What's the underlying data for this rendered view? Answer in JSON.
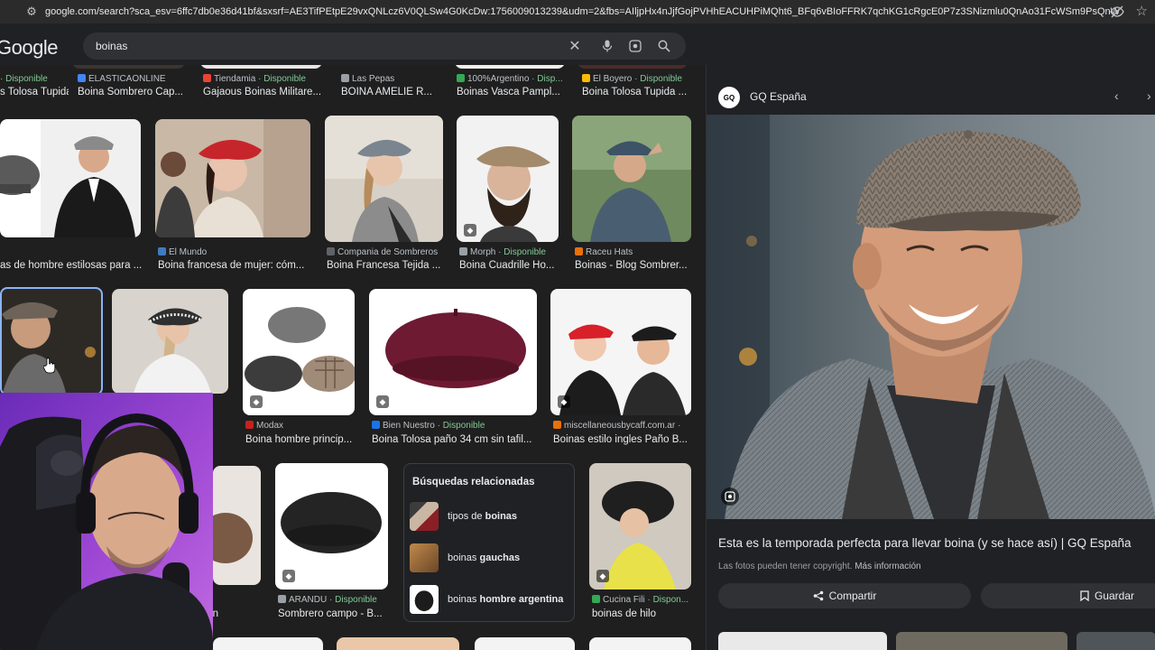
{
  "browser": {
    "url": "google.com/search?sca_esv=6ffc7db0e36d41bf&sxsrf=AE3TifPEtpE29vxQNLcz6V0QLSw4G0KcDw:1756009013239&udm=2&fbs=AIljpHx4nJjfGojPVHhEACUHPiMQht6_BFq6vBIoFFRK7qchKG1cRgcE0P7z3SNizmlu0QnAo31FcWSm9PsQnW8mPH2..."
  },
  "header": {
    "logo": "Google",
    "query": "boinas"
  },
  "row0": [
    {
      "meta": "· Disponible",
      "title": "s Tolosa Tupida ..."
    },
    {
      "meta": "ELASTICAONLINE",
      "title": "Boina Sombrero Cap..."
    },
    {
      "meta": "Tiendamia · Disponible",
      "source": "Tiendamia",
      "avail": "· Disponible",
      "title": "Gajaous Boinas Militare..."
    },
    {
      "meta": "Las Pepas",
      "title": "BOINA AMELIE R..."
    },
    {
      "source": "100%Argentino",
      "avail": "· Disp...",
      "title": "Boinas Vasca Pampl..."
    },
    {
      "source": "El Boyero",
      "avail": "· Disponible",
      "title": "Boina Tolosa Tupida ..."
    }
  ],
  "row1": [
    {
      "meta": "",
      "title": "as de hombre estilosas para ..."
    },
    {
      "source": "El Mundo",
      "title": "Boina francesa de mujer: cóm..."
    },
    {
      "source": "Compania de Sombreros",
      "title": "Boina Francesa Tejida ..."
    },
    {
      "source": "Morph",
      "avail": "· Disponible",
      "title": "Boina Cuadrille Ho..."
    },
    {
      "source": "Raceu Hats",
      "title": "Boinas - Blog Sombrer..."
    }
  ],
  "row2": [
    {
      "source": "Modax",
      "title": "Boina hombre princip..."
    },
    {
      "source": "Bien Nuestro",
      "avail": "· Disponible",
      "title": "Boina Tolosa paño 34 cm sin tafil..."
    },
    {
      "source": "miscellaneousbycaff.com.ar",
      "avail": "·",
      "title": "Boinas estilo ingles Paño B..."
    },
    {
      "left_title": "...n"
    }
  ],
  "row3": [
    {
      "source": "ARANDU",
      "avail": "· Disponible",
      "title": "Sombrero campo - B..."
    },
    {
      "source": "Cucina Fili",
      "avail": "· Dispon...",
      "title": "boinas de hilo"
    }
  ],
  "related": {
    "heading": "Búsquedas relacionadas",
    "items": [
      {
        "pre": "tipos de ",
        "bold": "",
        "post": "boinas"
      },
      {
        "pre": "boinas ",
        "bold": "gauchas",
        "post": ""
      },
      {
        "pre": "boinas ",
        "bold": "hombre argentina",
        "post": ""
      }
    ]
  },
  "panel": {
    "source_logo": "GQ",
    "source_name": "GQ España",
    "title": "Esta es la temporada perfecta para llevar boina (y se hace así) | GQ España",
    "copyright": "Las fotos pueden tener copyright.",
    "more_info": "Más información",
    "share_label": "Compartir",
    "save_label": "Guardar"
  }
}
